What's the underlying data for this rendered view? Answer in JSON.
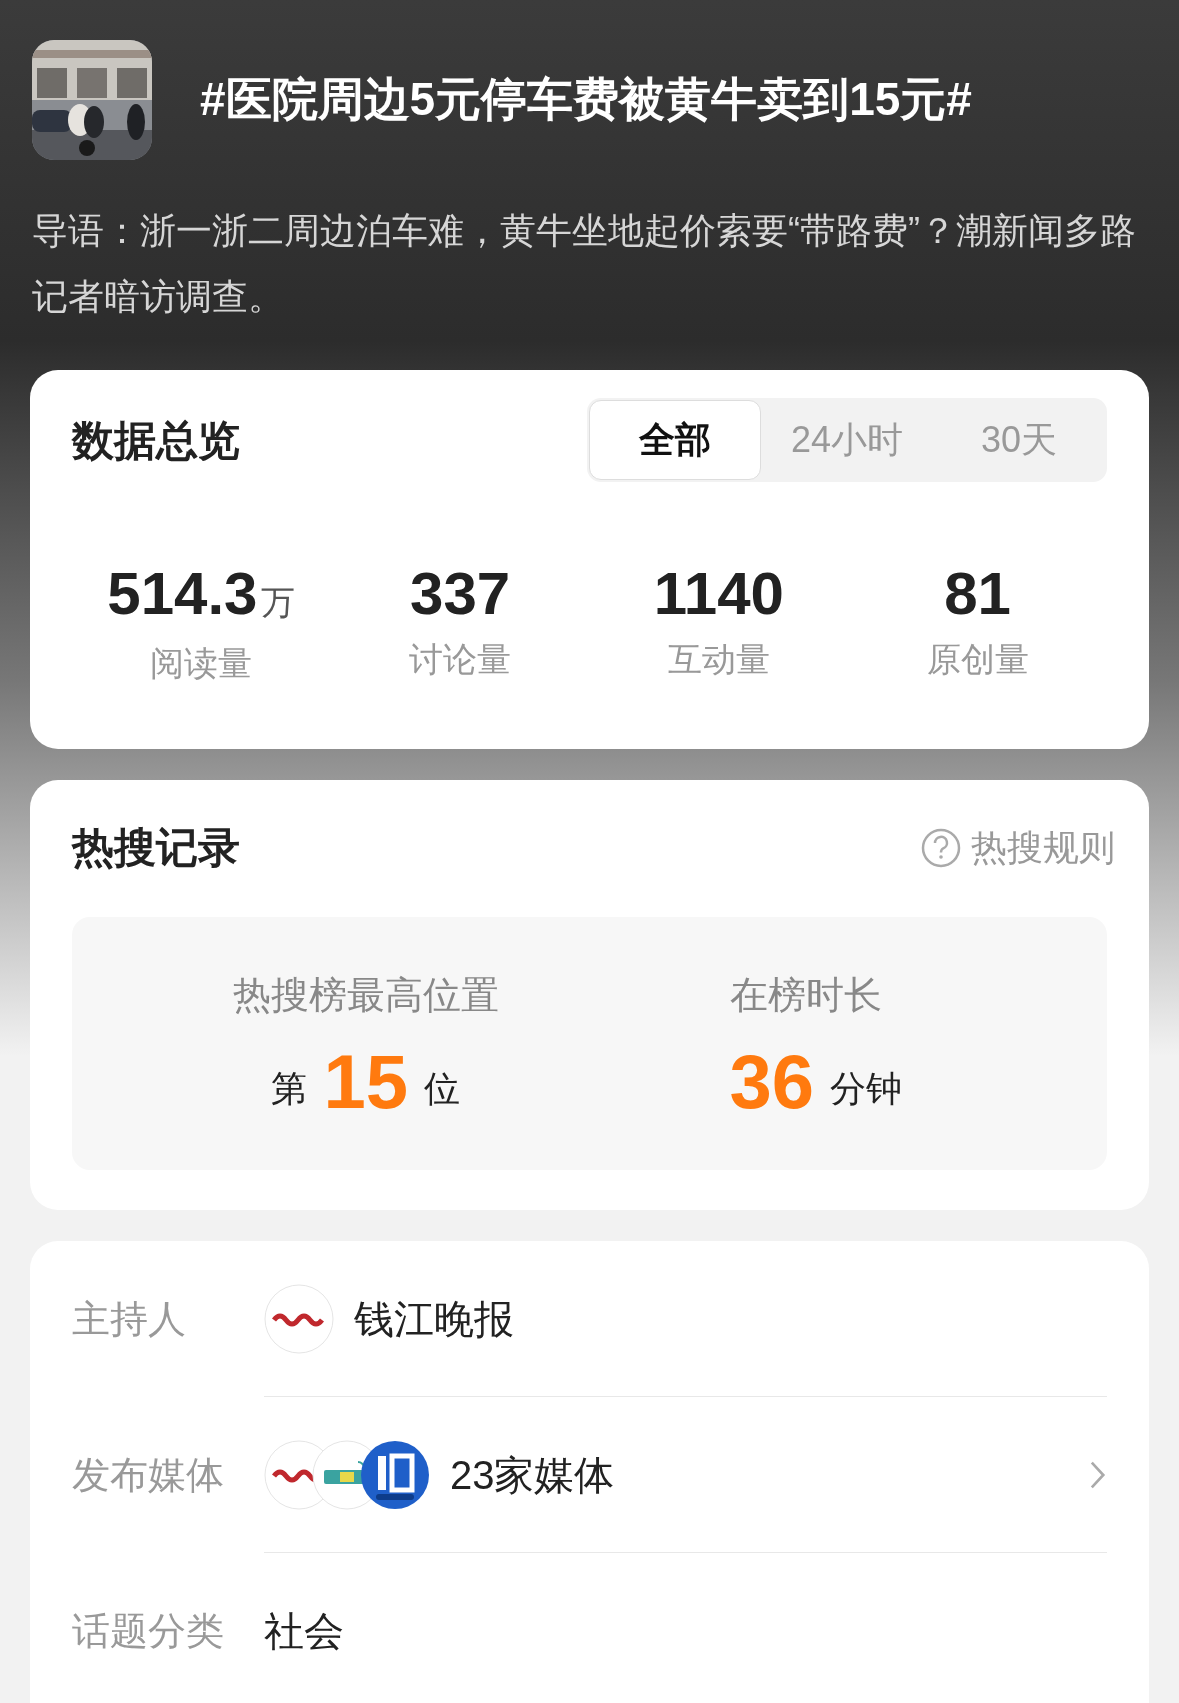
{
  "header": {
    "title": "#医院周边5元停车费被黄牛卖到15元#",
    "intro": "导语：浙一浙二周边泊车难，黄牛坐地起价索要“带路费”？潮新闻多路记者暗访调查。"
  },
  "overview": {
    "title": "数据总览",
    "tabs": [
      {
        "label": "全部",
        "selected": true
      },
      {
        "label": "24小时",
        "selected": false
      },
      {
        "label": "30天",
        "selected": false
      }
    ],
    "stats": [
      {
        "value": "514.3",
        "unit": "万",
        "label": "阅读量"
      },
      {
        "value": "337",
        "label": "讨论量"
      },
      {
        "value": "1140",
        "label": "互动量"
      },
      {
        "value": "81",
        "label": "原创量"
      }
    ]
  },
  "hot_search": {
    "title": "热搜记录",
    "rules_link": "热搜规则",
    "stats": [
      {
        "label": "热搜榜最高位置",
        "prefix": "第",
        "value": "15",
        "suffix": "位"
      },
      {
        "label": "在榜时长",
        "value": "36",
        "suffix": "分钟"
      }
    ]
  },
  "info": [
    {
      "kind": "account",
      "label": "主持人",
      "value": "钱江晚报"
    },
    {
      "kind": "media",
      "label": "发布媒体",
      "value": "23家媒体"
    },
    {
      "kind": "text",
      "label": "话题分类",
      "value": "社会"
    }
  ]
}
